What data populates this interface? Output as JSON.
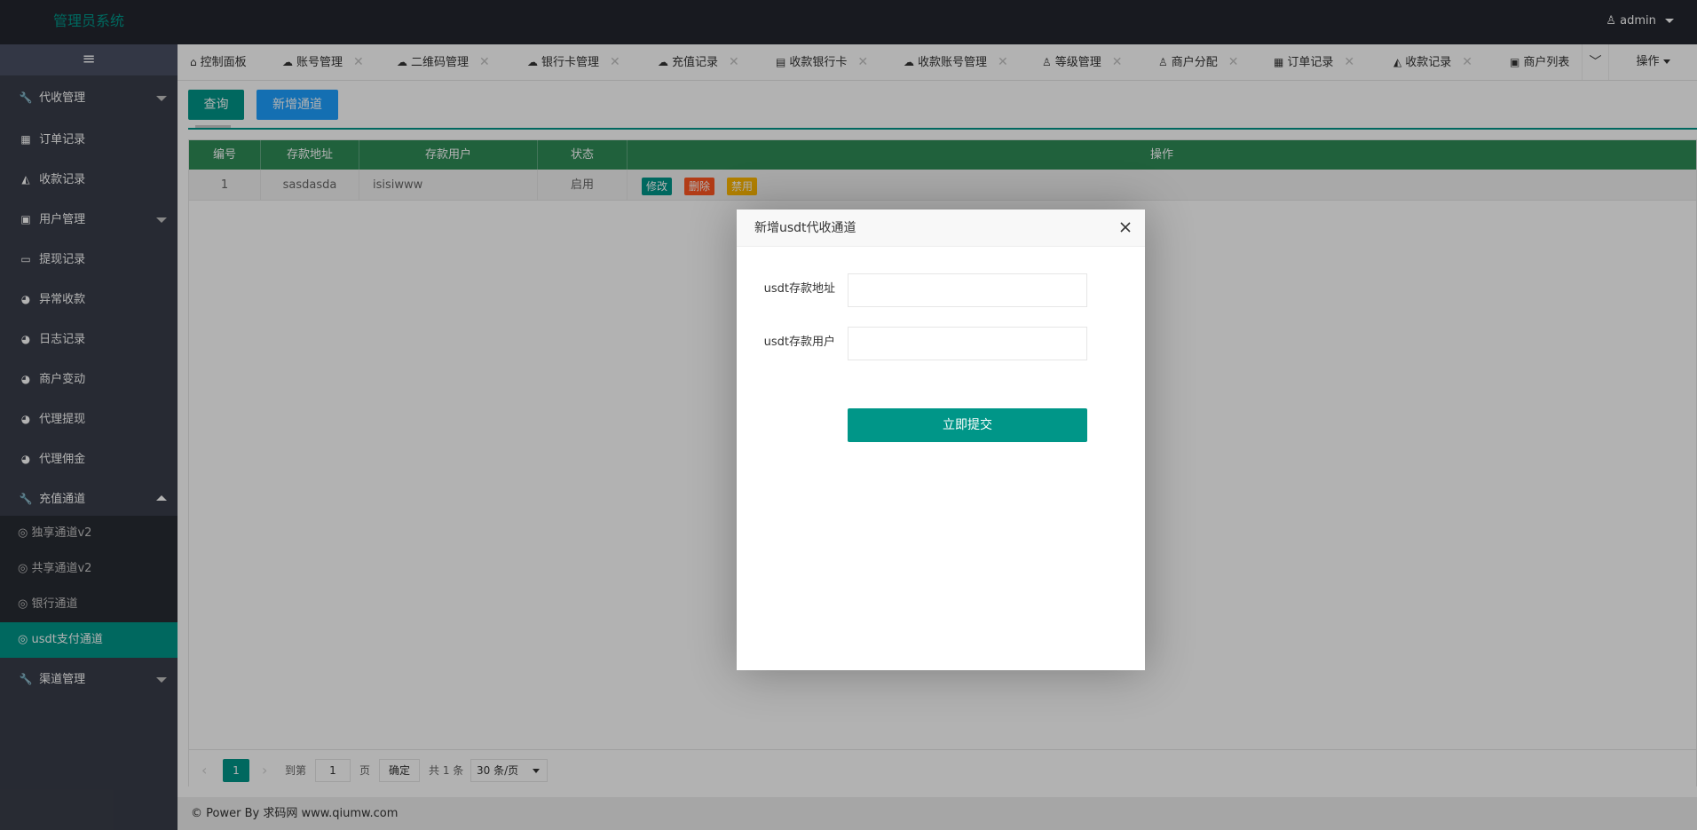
{
  "header": {
    "logo": "管理员系统",
    "user": "admin"
  },
  "sidebar": {
    "toggle": "≡",
    "items": [
      {
        "icon": "wrench-icon",
        "glyph": "🔧",
        "label": "代收管理",
        "expandable": true,
        "expanded": false
      },
      {
        "icon": "bar-chart-icon",
        "glyph": "▦",
        "label": "订单记录"
      },
      {
        "icon": "area-chart-icon",
        "glyph": "◭",
        "label": "收款记录"
      },
      {
        "icon": "address-book-icon",
        "glyph": "▣",
        "label": "用户管理",
        "expandable": true,
        "expanded": false
      },
      {
        "icon": "money-icon",
        "glyph": "▭",
        "label": "提现记录"
      },
      {
        "icon": "pie-chart-icon",
        "glyph": "◕",
        "label": "异常收款"
      },
      {
        "icon": "pie-chart-icon",
        "glyph": "◕",
        "label": "日志记录"
      },
      {
        "icon": "pie-chart-icon",
        "glyph": "◕",
        "label": "商户变动"
      },
      {
        "icon": "pie-chart-icon",
        "glyph": "◕",
        "label": "代理提现"
      },
      {
        "icon": "pie-chart-icon",
        "glyph": "◕",
        "label": "代理佣金"
      },
      {
        "icon": "wrench-icon",
        "glyph": "🔧",
        "label": "充值通道",
        "expandable": true,
        "expanded": true
      }
    ],
    "subitems": [
      {
        "icon": "wechat-icon",
        "glyph": "◎",
        "label": "独享通道v2"
      },
      {
        "icon": "wechat-icon",
        "glyph": "◎",
        "label": "共享通道v2"
      },
      {
        "icon": "wechat-icon",
        "glyph": "◎",
        "label": "银行通道"
      },
      {
        "icon": "wechat-icon",
        "glyph": "◎",
        "label": "usdt支付通道",
        "active": true
      }
    ],
    "last": {
      "icon": "wrench-icon",
      "glyph": "🔧",
      "label": "渠道管理",
      "expandable": true
    }
  },
  "tabs": [
    {
      "icon": "home-icon",
      "glyph": "⌂",
      "label": "控制面板",
      "closable": false
    },
    {
      "icon": "cloud-upload-icon",
      "glyph": "☁",
      "label": "账号管理",
      "closable": true
    },
    {
      "icon": "cloud-upload-icon",
      "glyph": "☁",
      "label": "二维码管理",
      "closable": true
    },
    {
      "icon": "cloud-upload-icon",
      "glyph": "☁",
      "label": "银行卡管理",
      "closable": true
    },
    {
      "icon": "cloud-upload-icon",
      "glyph": "☁",
      "label": "充值记录",
      "closable": true
    },
    {
      "icon": "book-icon",
      "glyph": "▤",
      "label": "收款银行卡",
      "closable": true
    },
    {
      "icon": "cloud-upload-icon",
      "glyph": "☁",
      "label": "收款账号管理",
      "closable": true
    },
    {
      "icon": "user-icon",
      "glyph": "♙",
      "label": "等级管理",
      "closable": true
    },
    {
      "icon": "user-icon",
      "glyph": "♙",
      "label": "商户分配",
      "closable": true
    },
    {
      "icon": "bar-chart-icon",
      "glyph": "▦",
      "label": "订单记录",
      "closable": true
    },
    {
      "icon": "area-chart-icon",
      "glyph": "◭",
      "label": "收款记录",
      "closable": true
    },
    {
      "icon": "address-book-icon",
      "glyph": "▣",
      "label": "商户列表",
      "closable": false
    }
  ],
  "tab_down": "﹀",
  "ops_label": "操作",
  "toolbar": {
    "query": "查询",
    "add": "新增通道"
  },
  "table": {
    "columns": [
      "编号",
      "存款地址",
      "存款用户",
      "状态",
      "操作"
    ],
    "rows": [
      {
        "id": "1",
        "address": "sasdasda",
        "user": "isisiwww",
        "status": "启用",
        "actions": [
          "修改",
          "删除",
          "禁用"
        ]
      }
    ]
  },
  "pager": {
    "prev": "‹",
    "current": "1",
    "next": "›",
    "goto": "到第",
    "page_value": "1",
    "page_unit": "页",
    "confirm": "确定",
    "total": "共 1 条",
    "per_page": "30 条/页"
  },
  "footer": "© Power By 求码网 www.qiumw.com",
  "modal": {
    "title": "新增usdt代收通道",
    "address_label": "usdt存款地址",
    "user_label": "usdt存款用户",
    "address_value": "",
    "user_value": "",
    "submit": "立即提交"
  },
  "colors": {
    "primary": "#009688",
    "blue": "#1e9fff",
    "header": "#23262e",
    "sidebar": "#393d49",
    "table_head": "#2e8b57",
    "btn_edit": "#009688",
    "btn_delete": "#ff5722",
    "btn_disable": "#ffb800"
  }
}
